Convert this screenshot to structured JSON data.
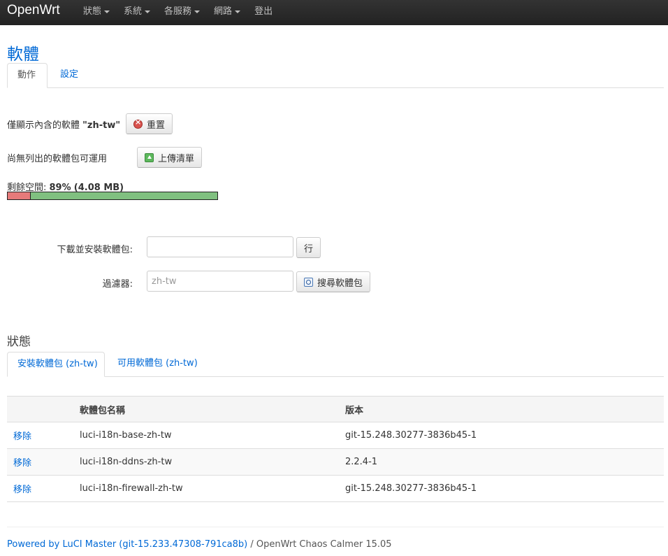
{
  "navbar": {
    "brand": "OpenWrt",
    "items": [
      {
        "label": "狀態",
        "has_dropdown": true
      },
      {
        "label": "系統",
        "has_dropdown": true
      },
      {
        "label": "各服務",
        "has_dropdown": true
      },
      {
        "label": "網路",
        "has_dropdown": true
      },
      {
        "label": "登出",
        "has_dropdown": false
      }
    ]
  },
  "page": {
    "title": "軟體",
    "tabs": [
      {
        "label": "動作",
        "active": true
      },
      {
        "label": "設定",
        "active": false
      }
    ]
  },
  "actions": {
    "filter_text_prefix": "僅顯示內含的軟體 ",
    "filter_text_value": "\"zh-tw\"",
    "reset_button": "重置",
    "no_list_text": "尚無列出的軟體包可運用",
    "upload_button": "上傳清單",
    "free_space_prefix": "剩餘空間: ",
    "free_space_value": "89%",
    "free_space_size": "(4.08 MB)",
    "free_space_percent": 89,
    "free_space_fraction": 0.89
  },
  "install": {
    "label": "下載並安裝軟體包:",
    "value": "",
    "button": "行"
  },
  "filter": {
    "label": "過濾器:",
    "placeholder": "zh-tw",
    "button": "搜尋軟體包"
  },
  "status": {
    "title": "狀態",
    "tabs": [
      {
        "label": "安裝軟體包 (zh-tw)",
        "active": true
      },
      {
        "label": "可用軟體包 (zh-tw)",
        "active": false
      }
    ],
    "table": {
      "headers": [
        "",
        "軟體包名稱",
        "版本"
      ],
      "rows": [
        {
          "action": "移除",
          "name": "luci-i18n-base-zh-tw",
          "version": "git-15.248.30277-3836b45-1"
        },
        {
          "action": "移除",
          "name": "luci-i18n-ddns-zh-tw",
          "version": "2.2.4-1"
        },
        {
          "action": "移除",
          "name": "luci-i18n-firewall-zh-tw",
          "version": "git-15.248.30277-3836b45-1"
        }
      ]
    }
  },
  "footer": {
    "link_text": "Powered by LuCI Master (git-15.233.47308-791ca8b)",
    "suffix": " / OpenWrt Chaos Calmer 15.05"
  },
  "colors": {
    "navbar_bg": "#222222",
    "link": "#0069d6",
    "space_used": "#e67a7a",
    "space_free": "#80c080"
  }
}
